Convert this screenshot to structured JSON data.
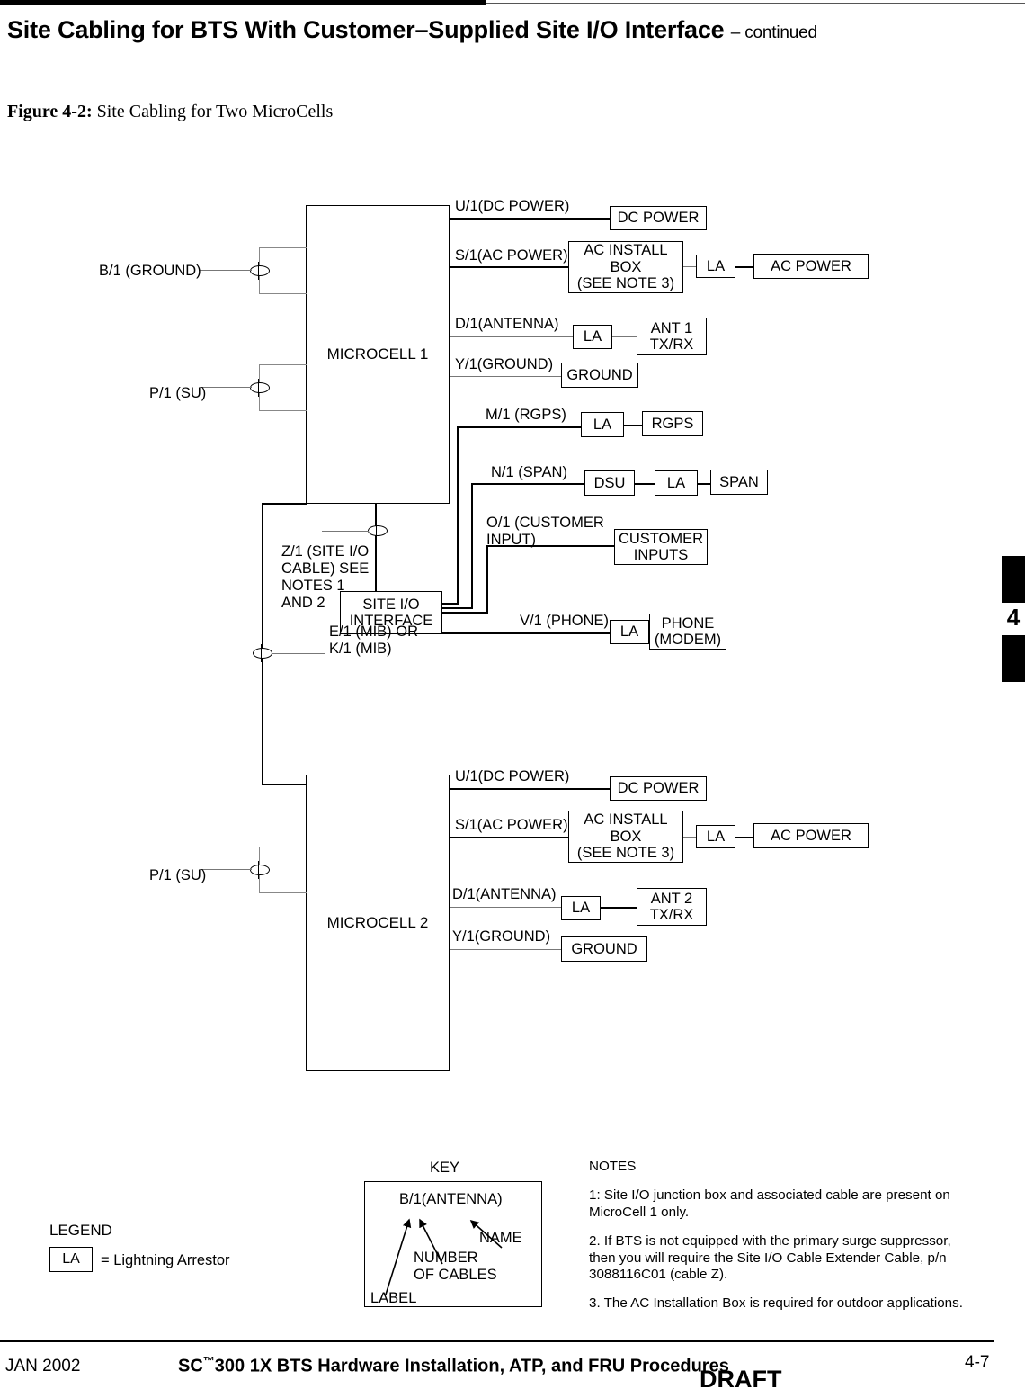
{
  "header": {
    "title": "Site Cabling for BTS With Customer–Supplied Site I/O Interface",
    "continued": "– continued"
  },
  "figure": {
    "number": "Figure 4-2:",
    "caption": "Site Cabling for Two MicroCells"
  },
  "chapter_tab": {
    "number": "4"
  },
  "diagram": {
    "microcell1": {
      "name": "MICROCELL 1",
      "left_ports": [
        {
          "label": "B/1 (GROUND)"
        },
        {
          "label": "P/1 (SU)"
        }
      ],
      "rows": [
        {
          "port": "U/1(DC POWER)",
          "chain": [
            {
              "label": "DC POWER"
            }
          ]
        },
        {
          "port": "S/1(AC POWER)",
          "chain": [
            {
              "label": "AC INSTALL\nBOX\n(SEE NOTE 3)"
            },
            {
              "label": "LA"
            },
            {
              "label": "AC POWER"
            }
          ]
        },
        {
          "port": "D/1(ANTENNA)",
          "chain": [
            {
              "label": "LA"
            },
            {
              "label": "ANT 1\nTX/RX"
            }
          ]
        },
        {
          "port": "Y/1(GROUND)",
          "chain": [
            {
              "label": "GROUND"
            }
          ]
        }
      ]
    },
    "siteio": {
      "name": "SITE I/O\nINTERFACE",
      "cable_label": "Z/1 (SITE I/O\nCABLE) SEE\nNOTES 1\nAND 2",
      "mib_label": "E/1 (MIB) OR\nK/1 (MIB)",
      "rows": [
        {
          "port": "M/1 (RGPS)",
          "chain": [
            {
              "label": "LA"
            },
            {
              "label": "RGPS"
            }
          ]
        },
        {
          "port": "N/1 (SPAN)",
          "chain": [
            {
              "label": "DSU"
            },
            {
              "label": "LA"
            },
            {
              "label": "SPAN"
            }
          ]
        },
        {
          "port": "O/1 (CUSTOMER\nINPUT)",
          "chain": [
            {
              "label": "CUSTOMER\nINPUTS"
            }
          ]
        },
        {
          "port": "V/1 (PHONE)",
          "chain": [
            {
              "label": "LA"
            },
            {
              "label": "PHONE\n(MODEM)"
            }
          ]
        }
      ]
    },
    "microcell2": {
      "name": "MICROCELL 2",
      "left_ports": [
        {
          "label": "P/1 (SU)"
        }
      ],
      "rows": [
        {
          "port": "U/1(DC POWER)",
          "chain": [
            {
              "label": "DC POWER"
            }
          ]
        },
        {
          "port": "S/1(AC POWER)",
          "chain": [
            {
              "label": "AC INSTALL\nBOX\n(SEE NOTE 3)"
            },
            {
              "label": "LA"
            },
            {
              "label": "AC POWER"
            }
          ]
        },
        {
          "port": "D/1(ANTENNA)",
          "chain": [
            {
              "label": "LA"
            },
            {
              "label": "ANT 2\nTX/RX"
            }
          ]
        },
        {
          "port": "Y/1(GROUND)",
          "chain": [
            {
              "label": "GROUND"
            }
          ]
        }
      ]
    }
  },
  "legend": {
    "title": "LEGEND",
    "symbol": "LA",
    "meaning": "= Lightning  Arrestor"
  },
  "key": {
    "title": "KEY",
    "sample": "B/1(ANTENNA)",
    "name_callout": "NAME",
    "number_callout": "NUMBER\nOF CABLES",
    "label_callout": "LABEL"
  },
  "notes": {
    "title": "NOTES",
    "items": [
      "1:  Site I/O junction box and associated cable are present on MicroCell 1 only.",
      "2.  If BTS is not equipped with the primary surge suppressor, then you will require the Site I/O Cable Extender Cable, p/n 3088116C01 (cable Z).",
      "3.  The AC Installation Box is required for outdoor applications."
    ]
  },
  "footer": {
    "date": "JAN 2002",
    "title_prefix": "SC",
    "title_tm": "™",
    "title_rest": "300 1X BTS Hardware Installation, ATP, and FRU Procedures",
    "draft": "DRAFT",
    "page": "4-7"
  }
}
